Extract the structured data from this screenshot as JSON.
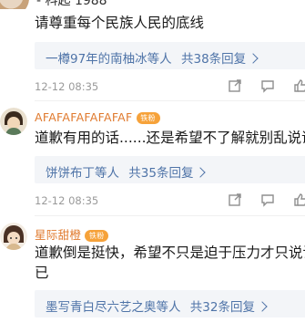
{
  "top_partial": {
    "name_fragment": "- 科起 1988"
  },
  "comments": [
    {
      "text_lines": [
        "请尊重每个民族人民的底线"
      ],
      "replies": {
        "names": "一樽97年的南柚冰等人",
        "count_label": "共38条回复"
      },
      "date": "12-12 08:35"
    },
    {
      "username": "AFAFAFAFAFAFAF",
      "badge": "铁粉",
      "text_lines": [
        "道歉有用的话......还是希望不了解就别乱说话"
      ],
      "replies": {
        "names": "饼饼布丁等人",
        "count_label": "共35条回复"
      },
      "date": "12-12 08:35"
    },
    {
      "username": "星际甜橙",
      "badge": "铁粉",
      "text_lines": [
        "道歉倒是挺快，希望不只是迫于压力才只说说而",
        "已"
      ],
      "replies": {
        "names": "墨写青白尽六艺之奥等人",
        "count_label": "共32条回复"
      }
    }
  ],
  "colors": {
    "link": "#4f74a8",
    "username": "#e07a2e",
    "badge": "#f6a23a",
    "meta": "#9a9a9a",
    "reply_bg": "#f3f5f8"
  },
  "icons": [
    "share-icon",
    "comment-icon",
    "like-icon"
  ]
}
